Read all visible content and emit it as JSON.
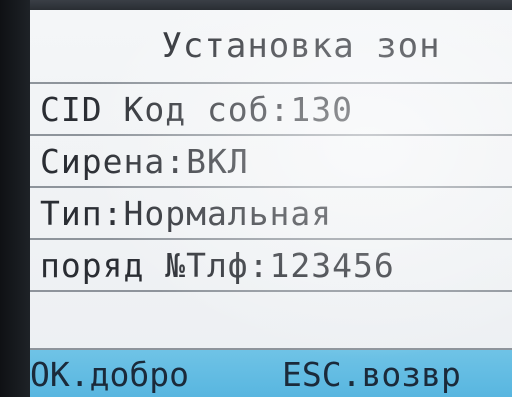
{
  "screen": {
    "title": "Установка зон",
    "rows": [
      {
        "label": "CID Код соб:130"
      },
      {
        "label": "Сирена:ВКЛ"
      },
      {
        "label": "Тип:Нормальная"
      },
      {
        "label": "поряд №Тлф:123456"
      },
      {
        "label": ""
      }
    ]
  },
  "softkeys": {
    "ok_label": "OK.добро",
    "esc_label": "ESC.возвр"
  },
  "colors": {
    "screen_bg": "#f1f3f5",
    "text": "#2a2d33",
    "softkey_bar": "#5fb9e2",
    "divider": "#8e949b"
  }
}
